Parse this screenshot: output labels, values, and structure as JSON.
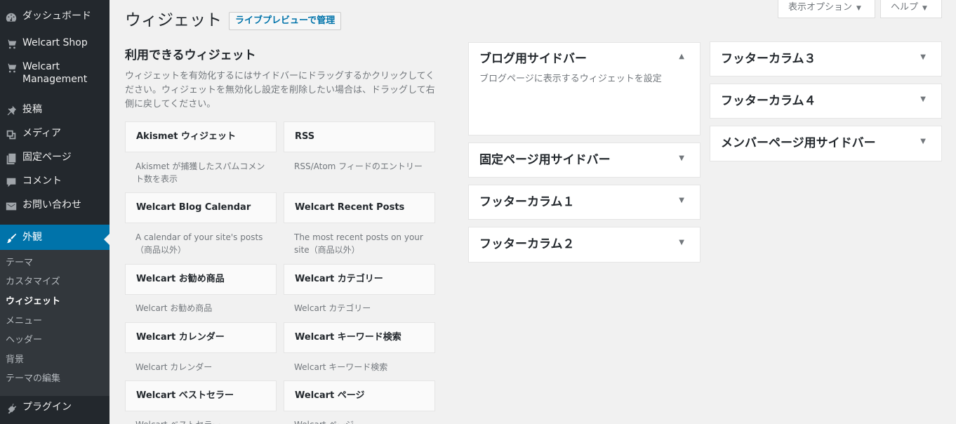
{
  "sidebar": {
    "items": [
      {
        "label": "ダッシュボード",
        "icon": "dashboard-icon"
      },
      {
        "label": "Welcart Shop",
        "icon": "cart-icon"
      },
      {
        "label": "Welcart Management",
        "icon": "cart-icon"
      },
      {
        "label": "投稿",
        "icon": "pin-icon"
      },
      {
        "label": "メディア",
        "icon": "media-icon"
      },
      {
        "label": "固定ページ",
        "icon": "page-icon"
      },
      {
        "label": "コメント",
        "icon": "comment-icon"
      },
      {
        "label": "お問い合わせ",
        "icon": "mail-icon"
      },
      {
        "label": "外観",
        "icon": "brush-icon"
      },
      {
        "label": "プラグイン",
        "icon": "plugin-icon"
      }
    ],
    "submenu": [
      "テーマ",
      "カスタマイズ",
      "ウィジェット",
      "メニュー",
      "ヘッダー",
      "背景",
      "テーマの編集"
    ],
    "accent": "#0073aa"
  },
  "header": {
    "title": "ウィジェット",
    "action": "ライブプレビューで管理",
    "screen_options": "表示オプション",
    "help": "ヘルプ",
    "arrow": "▼"
  },
  "available": {
    "title": "利用できるウィジェット",
    "description": "ウィジェットを有効化するにはサイドバーにドラッグするかクリックしてください。ウィジェットを無効化し設定を削除したい場合は、ドラッグして右側に戻してください。",
    "widgets": [
      {
        "title": "Akismet ウィジェット",
        "desc": "Akismet が捕獲したスパムコメント数を表示"
      },
      {
        "title": "RSS",
        "desc": "RSS/Atom フィードのエントリー"
      },
      {
        "title": "Welcart Blog Calendar",
        "desc": "A calendar of your site's posts（商品以外）"
      },
      {
        "title": "Welcart Recent Posts",
        "desc": "The most recent posts on your site（商品以外）"
      },
      {
        "title": "Welcart お勧め商品",
        "desc": "Welcart お勧め商品"
      },
      {
        "title": "Welcart カテゴリー",
        "desc": "Welcart カテゴリー"
      },
      {
        "title": "Welcart カレンダー",
        "desc": "Welcart カレンダー"
      },
      {
        "title": "Welcart キーワード検索",
        "desc": "Welcart キーワード検索"
      },
      {
        "title": "Welcart ベストセラー",
        "desc": "Welcart ベストセラー"
      },
      {
        "title": "Welcart ページ",
        "desc": "Welcart ページ"
      }
    ]
  },
  "sidebars": [
    {
      "title": "ブログ用サイドバー",
      "desc": "ブログページに表示するウィジェットを設定",
      "toggle": "▲"
    },
    {
      "title": "固定ページ用サイドバー",
      "toggle": "▼"
    },
    {
      "title": "フッターカラム１",
      "toggle": "▼"
    },
    {
      "title": "フッターカラム２",
      "toggle": "▼"
    },
    {
      "title": "フッターカラム３",
      "toggle": "▼"
    },
    {
      "title": "フッターカラム４",
      "toggle": "▼"
    },
    {
      "title": "メンバーページ用サイドバー",
      "toggle": "▼"
    }
  ]
}
